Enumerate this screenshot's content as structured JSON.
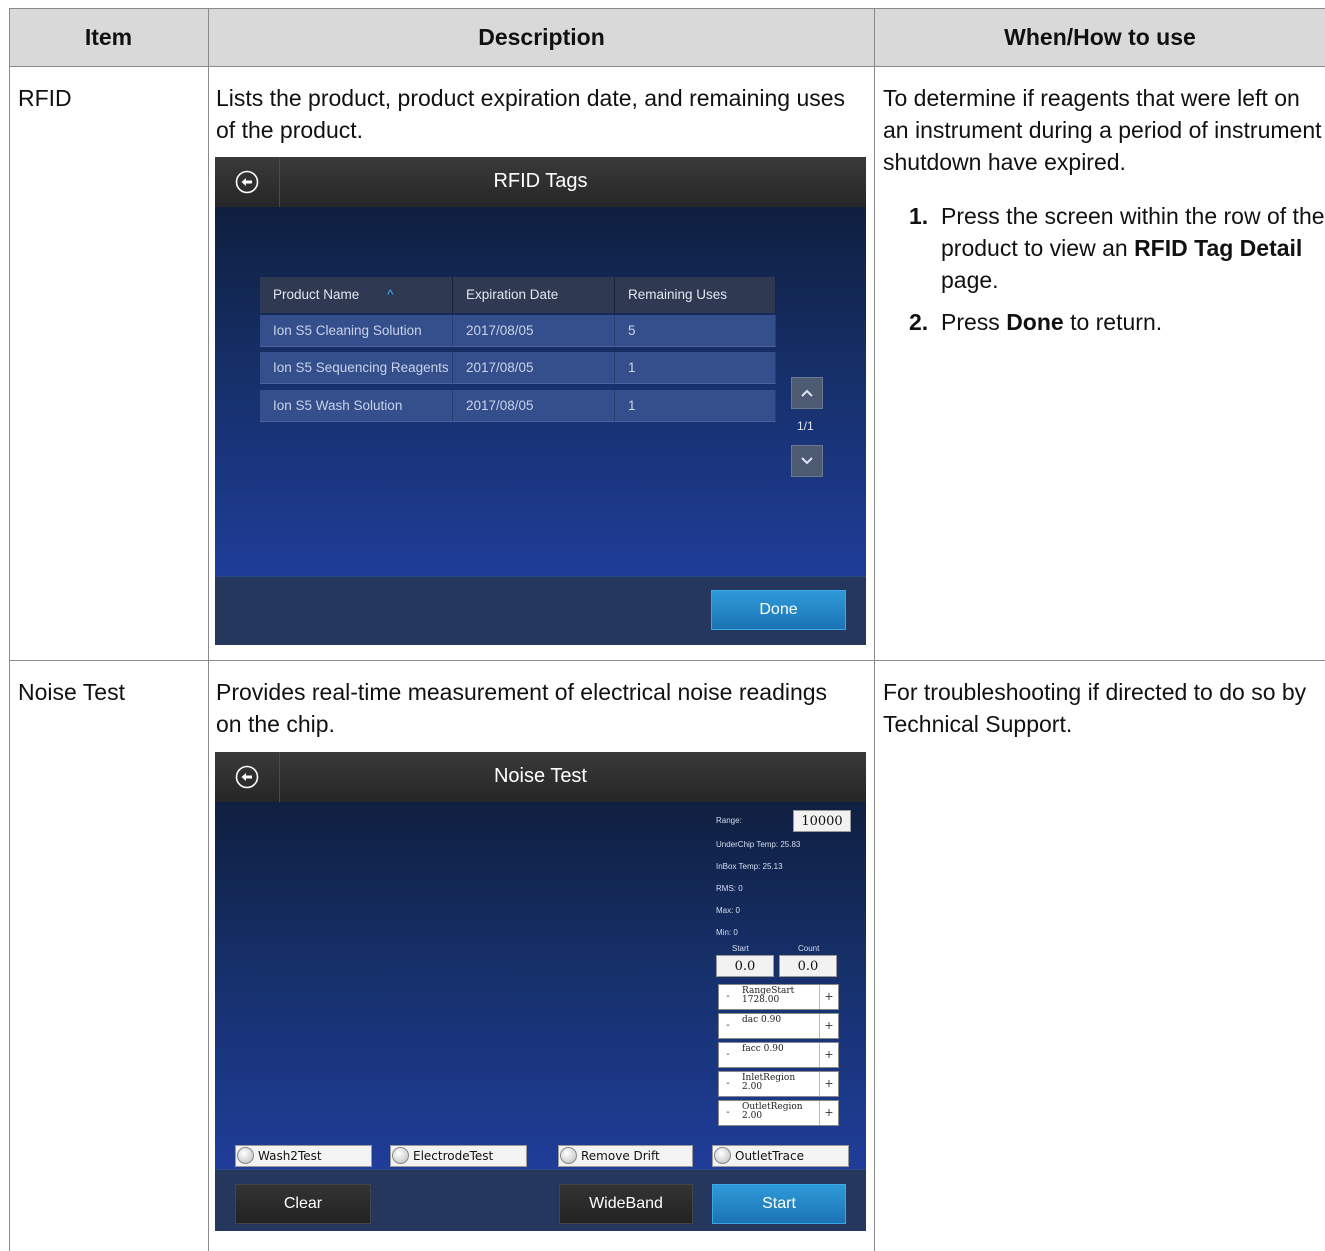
{
  "table": {
    "headers": [
      "Item",
      "Description",
      "When/How to use"
    ],
    "rows": [
      {
        "item": "RFID",
        "description": "Lists the product, product expiration date, and remaining uses of the product.",
        "when": "To determine if reagents that were left on an instrument during a period of instrument shutdown have expired.",
        "steps": [
          {
            "num": "1.",
            "pre": "Press the screen within the row of the product to view an ",
            "bold": "RFID Tag Detail",
            "post": " page."
          },
          {
            "num": "2.",
            "pre": "Press ",
            "bold": "Done",
            "post": " to return."
          }
        ]
      },
      {
        "item": "Noise Test",
        "description": "Provides real-time measurement of electrical noise readings on the chip.",
        "when": "For troubleshooting if directed to do so by Technical Support."
      }
    ]
  },
  "rfid_screen": {
    "title": "RFID Tags",
    "columns": [
      "Product Name",
      "Expiration Date",
      "Remaining Uses"
    ],
    "rows": [
      [
        "Ion S5 Cleaning Solution",
        "2017/08/05",
        "5"
      ],
      [
        "Ion S5 Sequencing Reagents",
        "2017/08/05",
        "1"
      ],
      [
        "Ion S5 Wash Solution",
        "2017/08/05",
        "1"
      ]
    ],
    "page_indicator": "1/1",
    "done_label": "Done"
  },
  "noise_screen": {
    "title": "Noise Test",
    "range_label": "Range:",
    "range_value": "10000",
    "underchip_temp": "UnderChip Temp: 25.83",
    "inbox_temp": "InBox Temp: 25.13",
    "rms": "RMS: 0",
    "max": "Max: 0",
    "min": "Min: 0",
    "start_label": "Start",
    "count_label": "Count",
    "start_value": "0.0",
    "count_value": "0.0",
    "steppers": [
      {
        "line1": "RangeStart",
        "line2": "1728.00"
      },
      {
        "line1": "dac 0.90",
        "line2": ""
      },
      {
        "line1": "facc 0.90",
        "line2": ""
      },
      {
        "line1": "InletRegion",
        "line2": "2.00"
      },
      {
        "line1": "OutletRegion",
        "line2": "2.00"
      }
    ],
    "stepper_minus": "-",
    "stepper_plus": "+",
    "checkboxes": [
      "Wash2Test",
      "ElectrodeTest",
      "Remove Drift",
      "OutletTrace"
    ],
    "clear_label": "Clear",
    "wideband_label": "WideBand",
    "start_button_label": "Start"
  },
  "colors": {
    "header_bg": "#d9d9d9",
    "screen_blue": "#2241a8",
    "button_blue": "#1b73b4",
    "sort_caret": "#3fb4ff"
  },
  "icons": [
    "back-arrow-icon",
    "sort-ascending-icon",
    "chevron-up-icon",
    "chevron-down-icon",
    "radio-icon"
  ]
}
